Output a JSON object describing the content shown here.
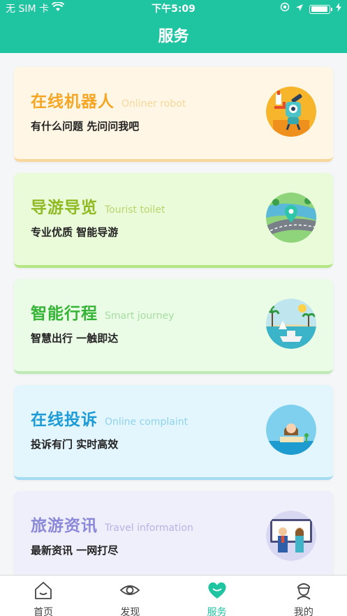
{
  "status_bar": {
    "carrier": "无 SIM 卡",
    "time": "下午5:09"
  },
  "nav": {
    "title": "服务"
  },
  "cards": [
    {
      "title": "在线机器人",
      "subtitle": "Onliner robot",
      "desc": "有什么问题 先问问我吧",
      "bg": "#fff6e5",
      "accent": "#f6a623",
      "sub_color": "#f7d89a",
      "bottom": "#f9d79c",
      "icon": "robot-icon"
    },
    {
      "title": "导游导览",
      "subtitle": "Tourist toilet",
      "desc": "专业优质 智能导游",
      "bg": "#eafbd9",
      "accent": "#8fba22",
      "sub_color": "#b9d46b",
      "bottom": "#b4e683",
      "icon": "map-road-icon"
    },
    {
      "title": "智能行程",
      "subtitle": "Smart journey",
      "desc": "智慧出行 一触即达",
      "bg": "#eafbe6",
      "accent": "#35b536",
      "sub_color": "#a6dea0",
      "bottom": "#bdeab5",
      "icon": "beach-island-icon"
    },
    {
      "title": "在线投诉",
      "subtitle": "Online complaint",
      "desc": "投诉有门 实时高效",
      "bg": "#e3f6fd",
      "accent": "#1d9bd6",
      "sub_color": "#8fd3ef",
      "bottom": "#a3dcf2",
      "icon": "service-woman-icon"
    },
    {
      "title": "旅游资讯",
      "subtitle": "Travel information",
      "desc": "最新资讯 一网打尽",
      "bg": "#efeffc",
      "accent": "#8b88d9",
      "sub_color": "#b5b3e6",
      "bottom": "#d2d0f4",
      "icon": "presenters-icon"
    }
  ],
  "tabbar": {
    "items": [
      {
        "label": "首页",
        "icon": "home-icon"
      },
      {
        "label": "发现",
        "icon": "eye-icon"
      },
      {
        "label": "服务",
        "icon": "heart-icon",
        "active": true
      },
      {
        "label": "我的",
        "icon": "profile-icon"
      }
    ],
    "active_color": "#1fc4a0"
  },
  "brand_color": "#1fc4a0"
}
